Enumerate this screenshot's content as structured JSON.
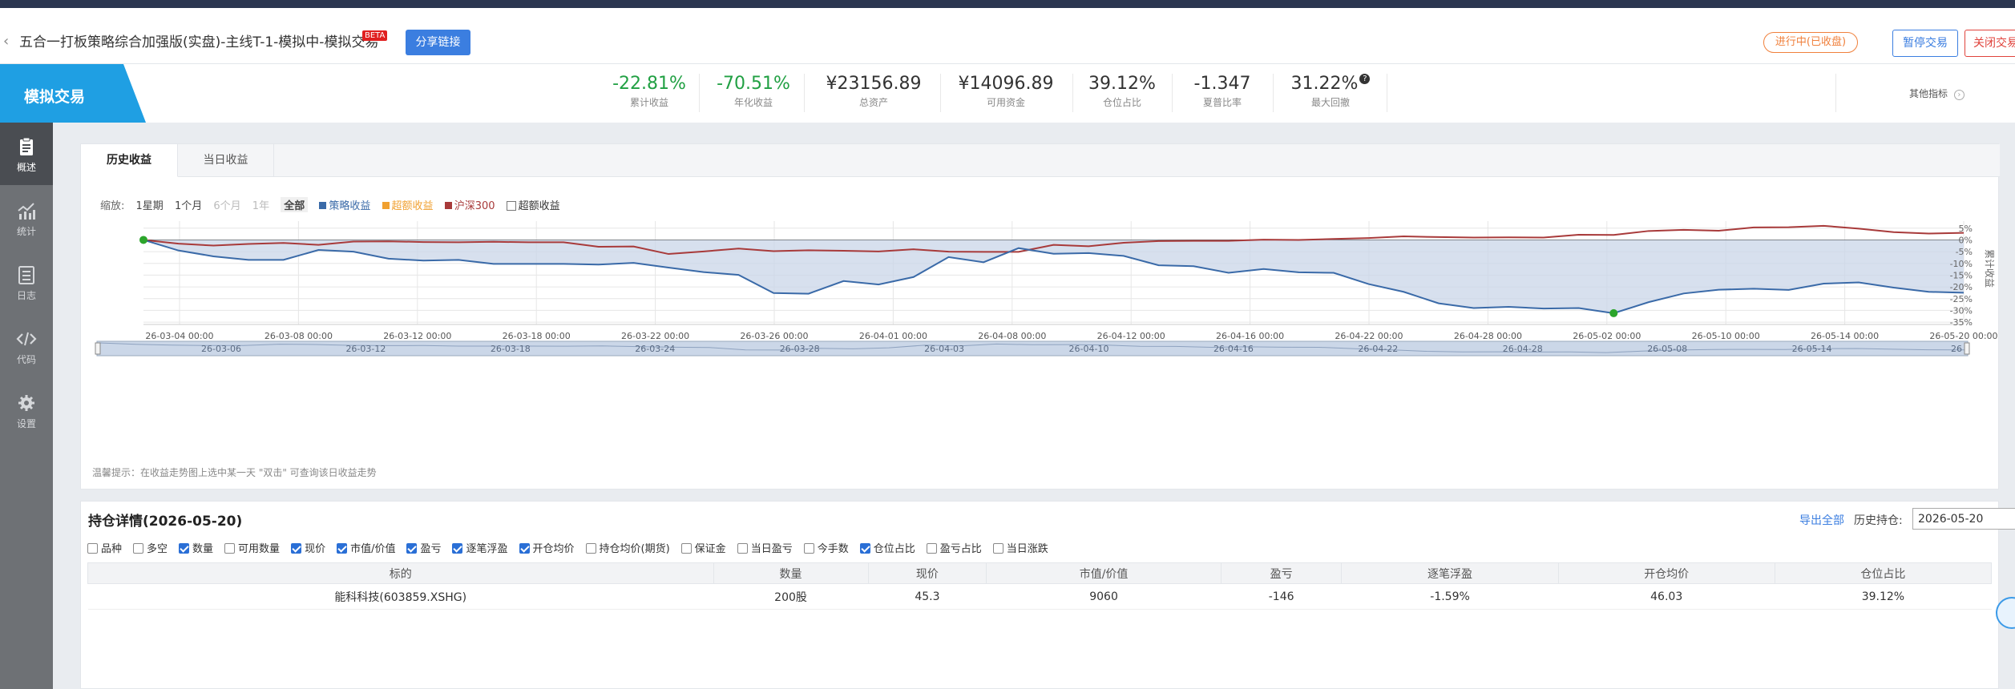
{
  "header": {
    "back_icon": "chevron-left-icon",
    "title": "五合一打板策略综合加强版(实盘)-主线T-1-模拟中-模拟交易",
    "beta": "BETA",
    "share_label": "分享链接",
    "status_label": "进行中(已收盘)",
    "pause_label": "暂停交易",
    "close_label": "关闭交易"
  },
  "metrics_bar": {
    "mode_label": "模拟交易",
    "items": [
      {
        "value": "-22.81%",
        "label": "累计收益",
        "color": "#21a043"
      },
      {
        "value": "-70.51%",
        "label": "年化收益",
        "color": "#21a043"
      },
      {
        "value": "¥23156.89",
        "label": "总资产",
        "color": "#222222"
      },
      {
        "value": "¥14096.89",
        "label": "可用资金",
        "color": "#222222"
      },
      {
        "value": "39.12%",
        "label": "仓位占比",
        "color": "#222222"
      },
      {
        "value": "-1.347",
        "label": "夏普比率",
        "color": "#222222"
      },
      {
        "value": "31.22%",
        "label": "最大回撤",
        "color": "#222222"
      }
    ],
    "help_icon": "question-circle-icon",
    "other_label": "其他指标",
    "other_icon": "chevron-right-circle-icon"
  },
  "sidebar": {
    "items": [
      {
        "label": "概述",
        "icon": "clipboard-icon",
        "active": true
      },
      {
        "label": "统计",
        "icon": "bar-chart-icon",
        "active": false
      },
      {
        "label": "日志",
        "icon": "log-list-icon",
        "active": false
      },
      {
        "label": "代码",
        "icon": "code-icon",
        "active": false
      },
      {
        "label": "设置",
        "icon": "gear-icon",
        "active": false
      }
    ]
  },
  "chart_panel": {
    "tabs": [
      "历史收益",
      "当日收益"
    ],
    "active_tab": 0,
    "zoom_label": "缩放:",
    "zoom_options": [
      "1星期",
      "1个月",
      "6个月",
      "1年",
      "全部"
    ],
    "zoom_disabled": [
      2,
      3
    ],
    "zoom_active": 4,
    "legend": [
      {
        "label": "策略收益",
        "color": "#3a6aa8"
      },
      {
        "label": "超额收益",
        "color": "#f0a030"
      },
      {
        "label": "沪深300",
        "color": "#a83a3a"
      }
    ],
    "excess_toggle_label": "超额收益",
    "hint": "温馨提示：在收益走势图上选中某一天 \"双击\" 可查询该日收益走势"
  },
  "chart_data": {
    "type": "line",
    "x_axis_labels": [
      "26-03-04 00:00",
      "26-03-08 00:00",
      "26-03-12 00:00",
      "26-03-18 00:00",
      "26-03-22 00:00",
      "26-03-26 00:00",
      "26-04-01 00:00",
      "26-04-08 00:00",
      "26-04-12 00:00",
      "26-04-16 00:00",
      "26-04-22 00:00",
      "26-04-28 00:00",
      "26-05-02 00:00",
      "26-05-10 00:00",
      "26-05-14 00:00",
      "26-05-20 00:00"
    ],
    "y_ticks": [
      "5%",
      "0%",
      "-5%",
      "-10%",
      "-15%",
      "-20%",
      "-25%",
      "-30%",
      "-35%"
    ],
    "ylim": [
      -36,
      8
    ],
    "ylabel": "累计收益",
    "navigator_labels": [
      "26-03-06",
      "26-03-12",
      "26-03-18",
      "26-03-24",
      "26-03-28",
      "26-04-03",
      "26-04-10",
      "26-04-16",
      "26-04-22",
      "26-04-28",
      "26-05-08",
      "26-05-14",
      "26"
    ],
    "series": [
      {
        "name": "策略收益",
        "color": "#3a6aa8",
        "values": [
          0,
          -4.5,
          -7,
          -8.5,
          -8.5,
          -4.3,
          -5,
          -8,
          -8.8,
          -8.5,
          -10.2,
          -10.2,
          -10.2,
          -10.5,
          -9.8,
          -11.8,
          -13.7,
          -14.9,
          -22.6,
          -22.9,
          -17.5,
          -19,
          -15.8,
          -7.3,
          -9.5,
          -3.5,
          -5.9,
          -5.6,
          -6.8,
          -10.8,
          -11.2,
          -14,
          -12.4,
          -13.8,
          -14,
          -18.8,
          -22.1,
          -27,
          -29,
          -28.5,
          -29.2,
          -29,
          -31.2,
          -26.5,
          -22.8,
          -21.2,
          -20.8,
          -21.3,
          -18.6,
          -18.1,
          -20.3,
          -22.1,
          -22.5
        ]
      },
      {
        "name": "沪深300",
        "color": "#a83a3a",
        "values": [
          0,
          -1.6,
          -2.4,
          -1.7,
          -1.3,
          -2.1,
          -0.7,
          -0.6,
          -0.9,
          -1,
          -0.8,
          -1,
          -1,
          -2.9,
          -2.8,
          -6,
          -4.9,
          -3.7,
          -4.8,
          -4.4,
          -4.6,
          -4.9,
          -4,
          -5,
          -5.1,
          -5.1,
          -2.1,
          -2.7,
          -1.2,
          -0.5,
          -0.4,
          -0.4,
          0.1,
          0,
          0.4,
          0.8,
          1.5,
          1.2,
          1,
          1.1,
          1,
          2.2,
          2.1,
          3.8,
          4.3,
          3.9,
          5.3,
          5.4,
          6,
          4.8,
          3.3,
          2.7,
          3
        ]
      }
    ],
    "highlight_points": [
      {
        "series": "策略收益",
        "index": 0,
        "value": 0
      },
      {
        "series": "策略收益",
        "index": 42,
        "value": -31.2
      }
    ],
    "grid": true,
    "legend_position": "top-left"
  },
  "holdings": {
    "title": "持仓详情(2026-05-20)",
    "export_label": "导出全部",
    "history_label": "历史持仓:",
    "history_date": "2026-05-20",
    "column_toggles": [
      {
        "label": "品种",
        "checked": false
      },
      {
        "label": "多空",
        "checked": false
      },
      {
        "label": "数量",
        "checked": true
      },
      {
        "label": "可用数量",
        "checked": false
      },
      {
        "label": "现价",
        "checked": true
      },
      {
        "label": "市值/价值",
        "checked": true
      },
      {
        "label": "盈亏",
        "checked": true
      },
      {
        "label": "逐笔浮盈",
        "checked": true
      },
      {
        "label": "开仓均价",
        "checked": true
      },
      {
        "label": "持仓均价(期货)",
        "checked": false
      },
      {
        "label": "保证金",
        "checked": false
      },
      {
        "label": "当日盈亏",
        "checked": false
      },
      {
        "label": "今手数",
        "checked": false
      },
      {
        "label": "仓位占比",
        "checked": true
      },
      {
        "label": "盈亏占比",
        "checked": false
      },
      {
        "label": "当日涨跌",
        "checked": false
      }
    ],
    "columns": [
      "标的",
      "数量",
      "现价",
      "市值/价值",
      "盈亏",
      "逐笔浮盈",
      "开仓均价",
      "仓位占比"
    ],
    "rows": [
      [
        "能科科技(603859.XSHG)",
        "200股",
        "45.3",
        "9060",
        "-146",
        "-1.59%",
        "46.03",
        "39.12%"
      ]
    ]
  },
  "floating_widget_icon": "chat-bubble-icon"
}
